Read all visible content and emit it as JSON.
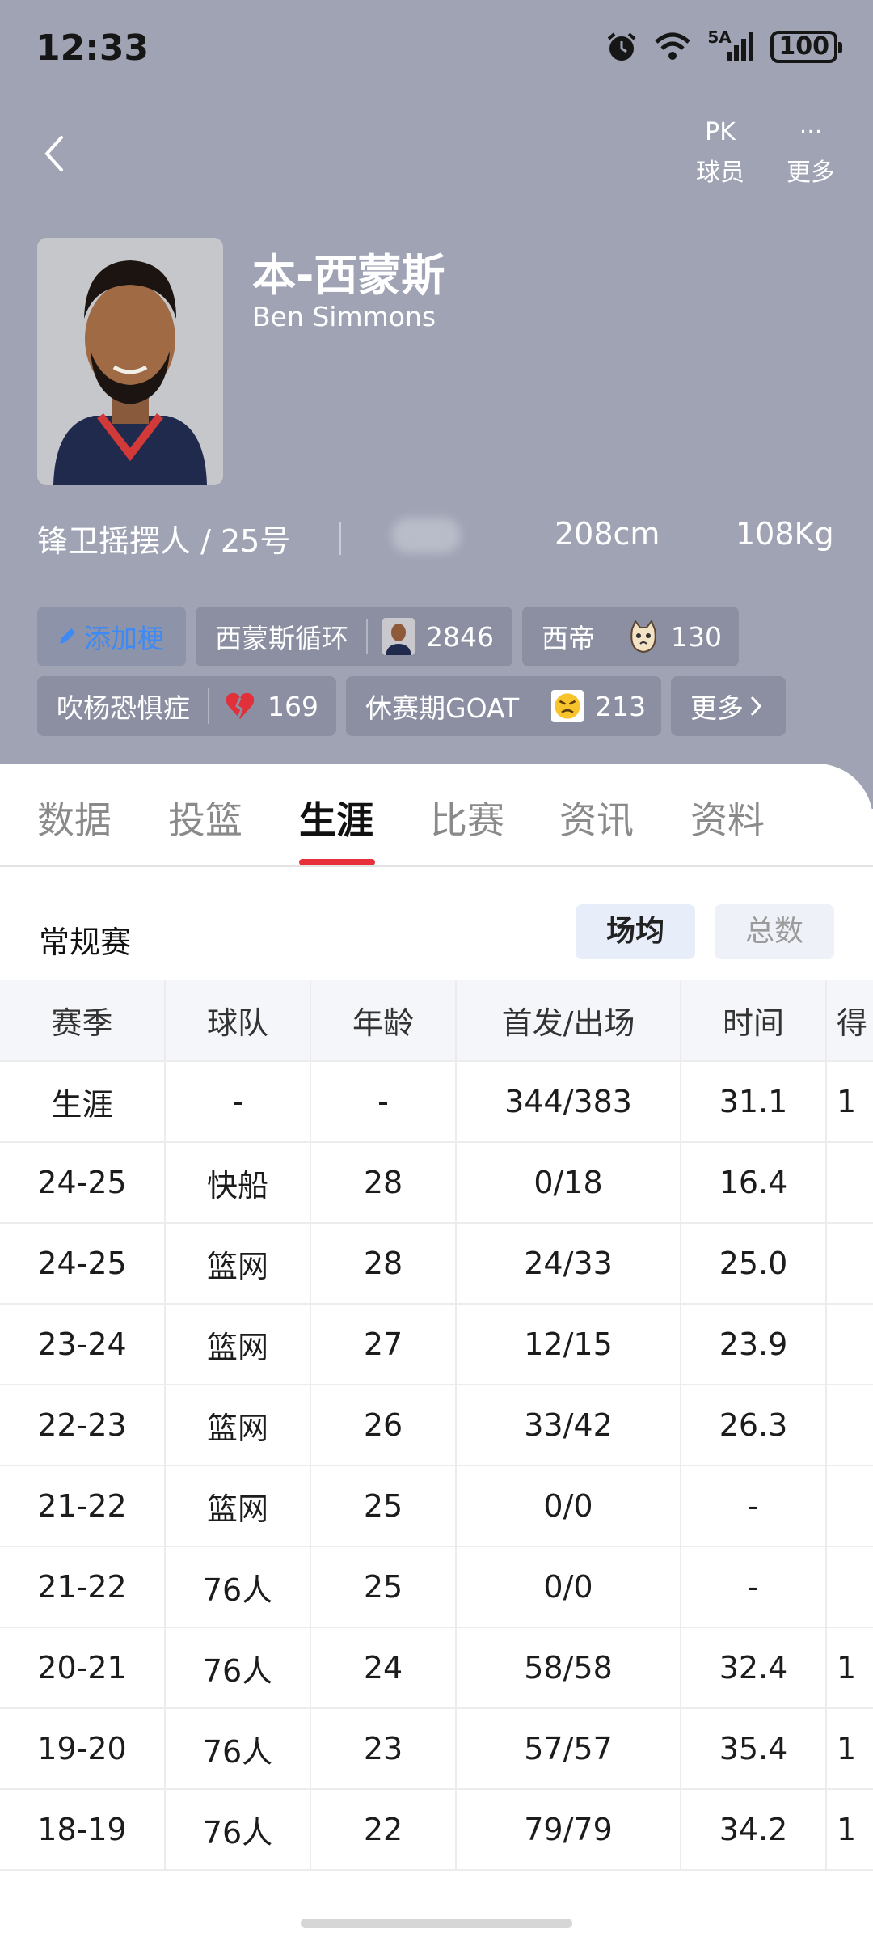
{
  "status": {
    "time": "12:33",
    "network": "5A",
    "battery": "100"
  },
  "top_actions": [
    {
      "icon": "pk-icon",
      "symbol": "PK",
      "label": "球员"
    },
    {
      "icon": "more-dots-icon",
      "symbol": "···",
      "label": "更多"
    }
  ],
  "player": {
    "name_cn": "本-西蒙斯",
    "name_en": "Ben Simmons",
    "position": "锋卫摇摆人 / 25号",
    "height": "208cm",
    "weight": "108Kg"
  },
  "tags": {
    "add_label": "添加梗",
    "items": [
      {
        "label": "西蒙斯循环",
        "emoji": "player-avatar-icon",
        "count": "2846"
      },
      {
        "label": "西帝",
        "emoji": "cat-face-icon",
        "count": "130"
      },
      {
        "label": "吹杨恐惧症",
        "emoji": "broken-heart-icon",
        "count": "169"
      },
      {
        "label": "休赛期GOAT",
        "emoji": "angry-emoji-icon",
        "count": "213"
      }
    ],
    "more_label": "更多"
  },
  "tabs": [
    "数据",
    "投篮",
    "生涯",
    "比赛",
    "资讯",
    "资料"
  ],
  "active_tab": "生涯",
  "section_title": "常规赛",
  "toggle": {
    "avg": "场均",
    "total": "总数"
  },
  "table": {
    "headers": [
      "赛季",
      "球队",
      "年龄",
      "首发/出场",
      "时间",
      "得"
    ],
    "rows": [
      [
        "生涯",
        "-",
        "-",
        "344/383",
        "31.1",
        "1"
      ],
      [
        "24-25",
        "快船",
        "28",
        "0/18",
        "16.4",
        ""
      ],
      [
        "24-25",
        "篮网",
        "28",
        "24/33",
        "25.0",
        ""
      ],
      [
        "23-24",
        "篮网",
        "27",
        "12/15",
        "23.9",
        ""
      ],
      [
        "22-23",
        "篮网",
        "26",
        "33/42",
        "26.3",
        ""
      ],
      [
        "21-22",
        "篮网",
        "25",
        "0/0",
        "-",
        ""
      ],
      [
        "21-22",
        "76人",
        "25",
        "0/0",
        "-",
        ""
      ],
      [
        "20-21",
        "76人",
        "24",
        "58/58",
        "32.4",
        "1"
      ],
      [
        "19-20",
        "76人",
        "23",
        "57/57",
        "35.4",
        "1"
      ],
      [
        "18-19",
        "76人",
        "22",
        "79/79",
        "34.2",
        "1"
      ]
    ]
  }
}
